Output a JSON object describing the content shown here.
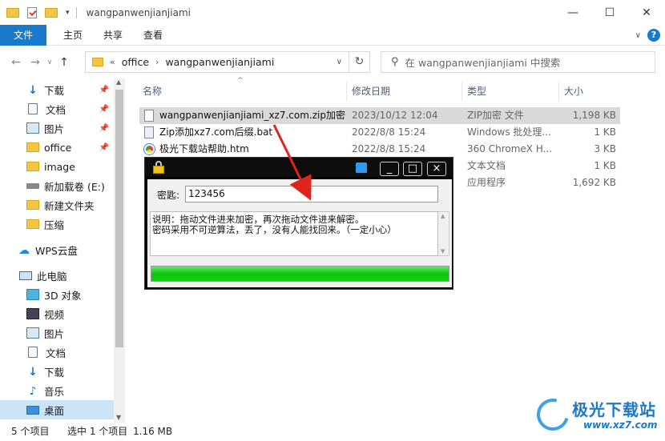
{
  "window": {
    "title": "wangpanwenjianjiami",
    "controls": [
      "—",
      "☐",
      "✕"
    ]
  },
  "ribbon": {
    "tabs": [
      "文件",
      "主页",
      "共享",
      "查看"
    ],
    "help": "?"
  },
  "address": {
    "overflow": "«",
    "crumbs": [
      "office",
      "wangpanwenjianjiami"
    ],
    "search_placeholder": "在 wangpanwenjianjiami 中搜索"
  },
  "sidebar": {
    "items": [
      {
        "label": "下载",
        "icon": "download-icon",
        "pinned": true
      },
      {
        "label": "文档",
        "icon": "document-icon",
        "pinned": true
      },
      {
        "label": "图片",
        "icon": "picture-icon",
        "pinned": true
      },
      {
        "label": "office",
        "icon": "folder-icon",
        "pinned": true
      },
      {
        "label": "image",
        "icon": "folder-icon",
        "pinned": false
      },
      {
        "label": "新加载卷 (E:)",
        "icon": "drive-icon",
        "pinned": false
      },
      {
        "label": "新建文件夹",
        "icon": "folder-icon",
        "pinned": false
      },
      {
        "label": "压缩",
        "icon": "folder-icon",
        "pinned": false
      },
      {
        "label": "WPS云盘",
        "icon": "cloud-icon",
        "pinned": false
      },
      {
        "label": "此电脑",
        "icon": "computer-icon",
        "pinned": false
      },
      {
        "label": "3D 对象",
        "icon": "3d-objects-icon",
        "pinned": false
      },
      {
        "label": "视频",
        "icon": "video-icon",
        "pinned": false
      },
      {
        "label": "图片",
        "icon": "picture-icon",
        "pinned": false
      },
      {
        "label": "文档",
        "icon": "document-icon",
        "pinned": false
      },
      {
        "label": "下载",
        "icon": "download-icon",
        "pinned": false
      },
      {
        "label": "音乐",
        "icon": "music-icon",
        "pinned": false
      },
      {
        "label": "桌面",
        "icon": "desktop-icon",
        "pinned": false,
        "selected": true
      }
    ]
  },
  "columns": [
    "名称",
    "修改日期",
    "类型",
    "大小"
  ],
  "files": [
    {
      "name": "wangpanwenjianjiami_xz7.com.zip加密",
      "date": "2023/10/12 12:04",
      "type": "ZIP加密 文件",
      "size": "1,198 KB",
      "selected": true
    },
    {
      "name": "Zip添加xz7.com后缀.bat",
      "date": "2022/8/8 15:24",
      "type": "Windows 批处理...",
      "size": "1 KB"
    },
    {
      "name": "极光下载站帮助.htm",
      "date": "2022/8/8 15:24",
      "type": "360 ChromeX H...",
      "size": "3 KB"
    },
    {
      "name": "",
      "date": "",
      "type": "文本文档",
      "size": "1 KB"
    },
    {
      "name": "",
      "date": "",
      "type": "应用程序",
      "size": "1,692 KB"
    }
  ],
  "status": {
    "count": "5 个项目",
    "selected": "选中 1 个项目",
    "size": "1.16 MB"
  },
  "popup": {
    "password_label": "密匙:",
    "password_value": "123456",
    "note_line1": "说明：拖动文件进来加密，再次拖动文件进来解密。",
    "note_line2": "密码采用不可逆算法，丢了，没有人能找回来。（一定小心）",
    "buttons": [
      "_",
      "□",
      "×"
    ],
    "progress": 1.0
  },
  "watermark": {
    "brand": "极光下载站",
    "url": "www.xz7.com"
  }
}
